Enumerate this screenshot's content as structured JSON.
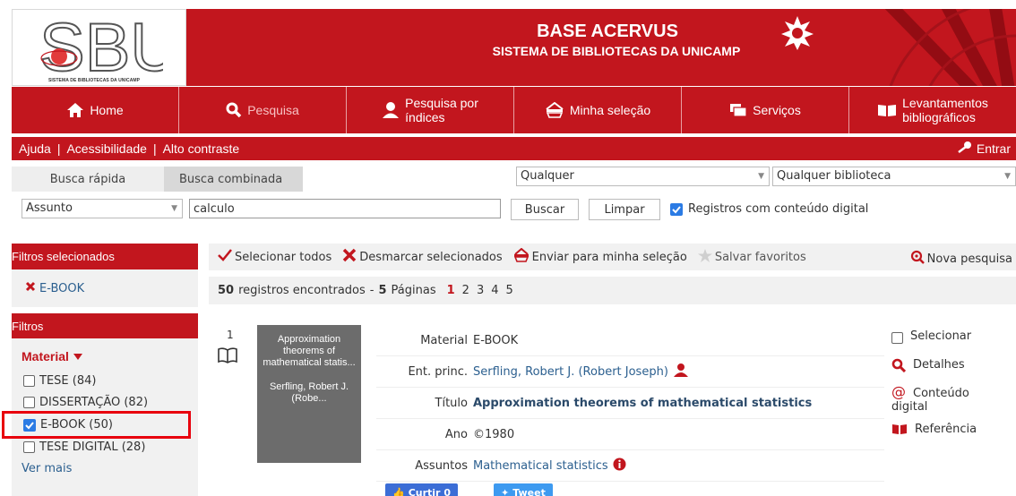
{
  "header": {
    "logo_text": "SBU",
    "logo_caption": "SISTEMA DE BIBLIOTECAS DA UNICAMP",
    "title": "BASE ACERVUS",
    "subtitle": "SISTEMA DE BIBLIOTECAS DA UNICAMP"
  },
  "nav": {
    "items": [
      {
        "label": "Home",
        "icon": "home-icon"
      },
      {
        "label": "Pesquisa",
        "icon": "search-icon",
        "active": true
      },
      {
        "label_1": "Pesquisa por",
        "label_2": "índices",
        "icon": "person-icon"
      },
      {
        "label": "Minha seleção",
        "icon": "basket-icon"
      },
      {
        "label": "Serviços",
        "icon": "services-icon"
      },
      {
        "label_1": "Levantamentos",
        "label_2": "bibliográficos",
        "icon": "book-open-icon"
      }
    ]
  },
  "utility": {
    "help": "Ajuda",
    "accessibility": "Acessibilidade",
    "contrast": "Alto contraste",
    "login": "Entrar"
  },
  "search": {
    "tab_quick": "Busca rápida",
    "tab_combined": "Busca combinada",
    "field_any": "Qualquer",
    "library": "Qualquer biblioteca",
    "field": "Assunto",
    "query": "calculo",
    "search_button": "Buscar",
    "clear_button": "Limpar",
    "digital_only_label": "Registros com conteúdo digital",
    "digital_only_checked": true
  },
  "sidebar": {
    "selected_title": "Filtros selecionados",
    "selected_filter": "E-BOOK",
    "filters_title": "Filtros",
    "material_title": "Material",
    "materials": [
      {
        "label": "TESE (84)",
        "checked": false
      },
      {
        "label": "DISSERTAÇÃO (82)",
        "checked": false
      },
      {
        "label": "E-BOOK (50)",
        "checked": true
      },
      {
        "label": "TESE DIGITAL (28)",
        "checked": false
      }
    ],
    "see_more": "Ver mais"
  },
  "toolbar": {
    "select_all": "Selecionar todos",
    "deselect": "Desmarcar selecionados",
    "send": "Enviar para minha seleção",
    "save": "Salvar favoritos",
    "new_search": "Nova pesquisa"
  },
  "results": {
    "count": "50",
    "count_text": "registros encontrados",
    "dash": "-",
    "pages_count": "5",
    "pages_text": "Páginas",
    "pages": [
      "1",
      "2",
      "3",
      "4",
      "5"
    ],
    "current_page": "1"
  },
  "record": {
    "number": "1",
    "cover_title": "Approximation theorems of mathematical statis...",
    "cover_author": "Serfling, Robert J. (Robe...",
    "fields": [
      {
        "key": "Material",
        "value": "E-BOOK"
      },
      {
        "key": "Ent. princ.",
        "value": "Serfling, Robert J. (Robert Joseph)"
      },
      {
        "key": "Título",
        "value": "Approximation theorems of mathematical statistics"
      },
      {
        "key": "Ano",
        "value": "©1980"
      },
      {
        "key": "Assuntos",
        "value": "Mathematical statistics"
      }
    ],
    "actions": {
      "select": "Selecionar",
      "details": "Detalhes",
      "content_1": "Conteúdo",
      "content_2": "digital",
      "reference": "Referência"
    }
  },
  "social": {
    "like": "Curtir 0",
    "tweet": "Tweet"
  },
  "colors": {
    "brand_red": "#c2161e",
    "link_blue": "#2b5f8f",
    "checkbox_blue": "#2b7be4",
    "highlight_red": "#e8000d"
  }
}
